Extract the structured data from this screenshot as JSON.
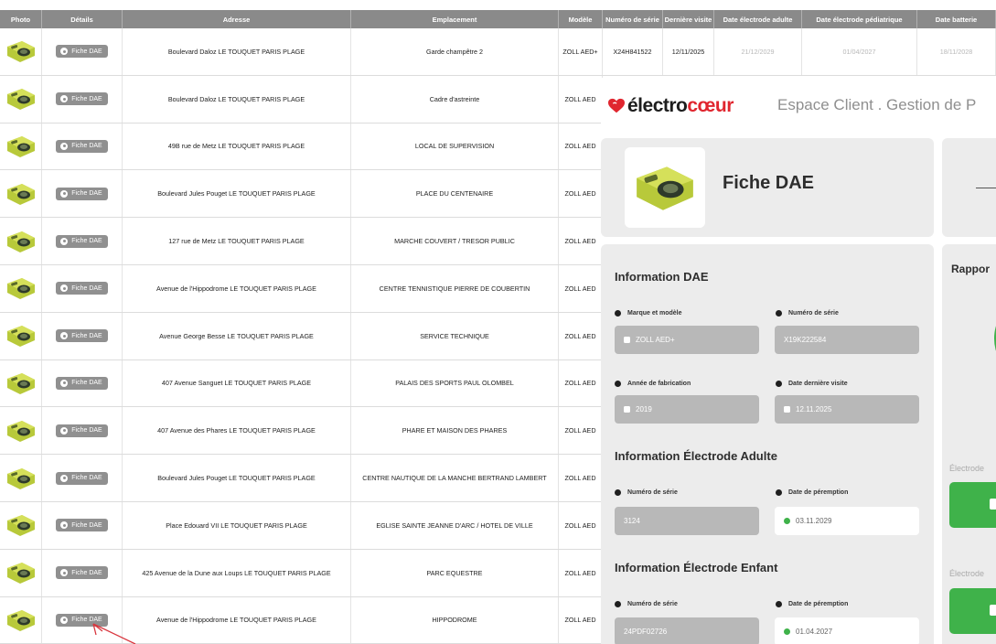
{
  "table": {
    "headers": [
      "Photo",
      "Détails",
      "Adresse",
      "Emplacement",
      "Modèle",
      "Numéro de série",
      "Dernière visite",
      "Date électrode adulte",
      "Date électrode pédiatrique",
      "Date batterie"
    ],
    "button_label": "Fiche DAE",
    "rows": [
      {
        "adresse": "Boulevard Daloz LE TOUQUET PARIS PLAGE",
        "emplacement": "Garde champêtre 2",
        "modele": "ZOLL AED+",
        "serie": "X24H841522",
        "visite": "12/11/2025",
        "adulte": "21/12/2029",
        "pedia": "01/04/2027",
        "batterie": "18/11/2028"
      },
      {
        "adresse": "Boulevard Daloz LE TOUQUET PARIS PLAGE",
        "emplacement": "Cadre d'astreinte",
        "modele": "ZOLL AED"
      },
      {
        "adresse": "49B rue de Metz LE TOUQUET PARIS PLAGE",
        "emplacement": "LOCAL DE SUPERVISION",
        "modele": "ZOLL AED"
      },
      {
        "adresse": "Boulevard Jules Pouget LE TOUQUET PARIS PLAGE",
        "emplacement": "PLACE DU CENTENAIRE",
        "modele": "ZOLL AED"
      },
      {
        "adresse": "127 rue de Metz LE TOUQUET PARIS PLAGE",
        "emplacement": "MARCHE COUVERT / TRESOR PUBLIC",
        "modele": "ZOLL AED"
      },
      {
        "adresse": "Avenue de l'Hippodrome LE TOUQUET PARIS PLAGE",
        "emplacement": "CENTRE TENNISTIQUE PIERRE DE COUBERTIN",
        "modele": "ZOLL AED"
      },
      {
        "adresse": "Avenue George Besse LE TOUQUET PARIS PLAGE",
        "emplacement": "SERVICE TECHNIQUE",
        "modele": "ZOLL AED"
      },
      {
        "adresse": "407 Avenue Sanguet LE TOUQUET PARIS PLAGE",
        "emplacement": "PALAIS DES SPORTS PAUL OLOMBEL",
        "modele": "ZOLL AED"
      },
      {
        "adresse": "407 Avenue des Phares LE TOUQUET PARIS PLAGE",
        "emplacement": "PHARE ET MAISON DES PHARES",
        "modele": "ZOLL AED"
      },
      {
        "adresse": "Boulevard Jules Pouget LE TOUQUET PARIS PLAGE",
        "emplacement": "CENTRE NAUTIQUE DE LA MANCHE BERTRAND LAMBERT",
        "modele": "ZOLL AED"
      },
      {
        "adresse": "Place Edouard VII LE TOUQUET PARIS PLAGE",
        "emplacement": "EGLISE SAINTE JEANNE D'ARC / HOTEL DE VILLE",
        "modele": "ZOLL AED"
      },
      {
        "adresse": "425 Avenue de la Dune aux Loups LE TOUQUET PARIS PLAGE",
        "emplacement": "PARC EQUESTRE",
        "modele": "ZOLL AED"
      },
      {
        "adresse": "Avenue de l'Hippodrome LE TOUQUET PARIS PLAGE",
        "emplacement": "HIPPODROME",
        "modele": "ZOLL AED"
      }
    ]
  },
  "overlay": {
    "brand_part1": "électro",
    "brand_part2": "cœur",
    "tagline": "Espace Client . Gestion de P",
    "fiche_title": "Fiche DAE",
    "dash_text": "—",
    "info_dae": {
      "title": "Information DAE",
      "marque_label": "Marque et modèle",
      "marque_value": "ZOLL AED+",
      "serie_label": "Numéro de série",
      "serie_value": "X19K222584",
      "annee_label": "Année de fabrication",
      "annee_value": "2019",
      "visite_label": "Date dernière visite",
      "visite_value": "12.11.2025"
    },
    "electrode_adulte": {
      "title": "Information Électrode Adulte",
      "serie_label": "Numéro de série",
      "serie_value": "3124",
      "peremption_label": "Date de péremption",
      "peremption_value": "03.11.2029"
    },
    "electrode_enfant": {
      "title": "Information Électrode Enfant",
      "serie_label": "Numéro de série",
      "serie_value": "24PDF02726",
      "peremption_label": "Date de péremption",
      "peremption_value": "01.04.2027"
    },
    "rapport_title": "Rappor",
    "electrode_label_1": "Électrode",
    "electrode_label_2": "Électrode"
  },
  "colors": {
    "brand_red": "#e0262f",
    "green": "#3fb24a",
    "header_gray": "#8a8a8a",
    "annotation_red": "#d9363e"
  }
}
